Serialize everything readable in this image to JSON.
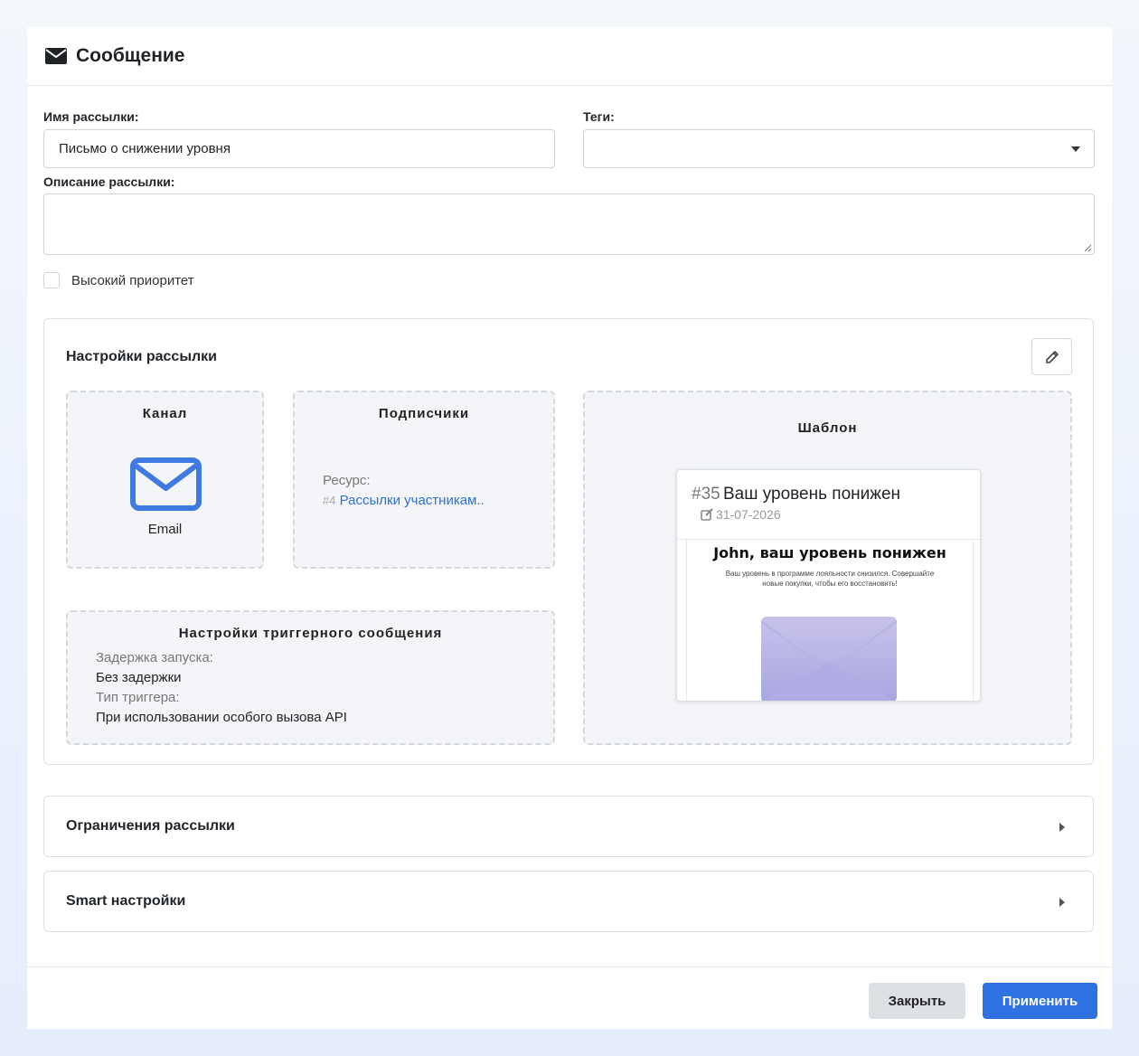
{
  "header": {
    "title": "Сообщение",
    "icon": "envelope-icon"
  },
  "form": {
    "name_label": "Имя рассылки:",
    "name_value": "Письмо о снижении уровня",
    "tags_label": "Теги:",
    "tags_value": "",
    "description_label": "Описание рассылки:",
    "description_value": "",
    "priority_label": "Высокий приоритет",
    "priority_checked": false
  },
  "settings": {
    "title": "Настройки рассылки",
    "channel": {
      "title": "Канал",
      "value": "Email",
      "icon": "envelope-icon",
      "color": "#3d7be0"
    },
    "subscribers": {
      "title": "Подписчики",
      "resource_label": "Ресурс:",
      "resource_id": "#4",
      "resource_link": "Рассылки участникам.."
    },
    "template": {
      "title": "Шаблон",
      "number": "#35",
      "name": "Ваш уровень понижен",
      "date": "31-07-2026",
      "preview_heading": "John, ваш уровень понижен",
      "preview_text": "Ваш уровень в программе лояльности снизился. Совершайте новые покупки, чтобы его восстановить!"
    },
    "trigger": {
      "title": "Настройки триггерного сообщения",
      "delay_label": "Задержка запуска:",
      "delay_value": "Без задержки",
      "type_label": "Тип триггера:",
      "type_value": "При использовании особого вызова API"
    }
  },
  "sections": {
    "limits_title": "Ограничения рассылки",
    "smart_title": "Smart настройки"
  },
  "footer": {
    "close_label": "Закрыть",
    "apply_label": "Применить"
  },
  "colors": {
    "accent": "#2d72e0",
    "link": "#2f6fd1"
  }
}
